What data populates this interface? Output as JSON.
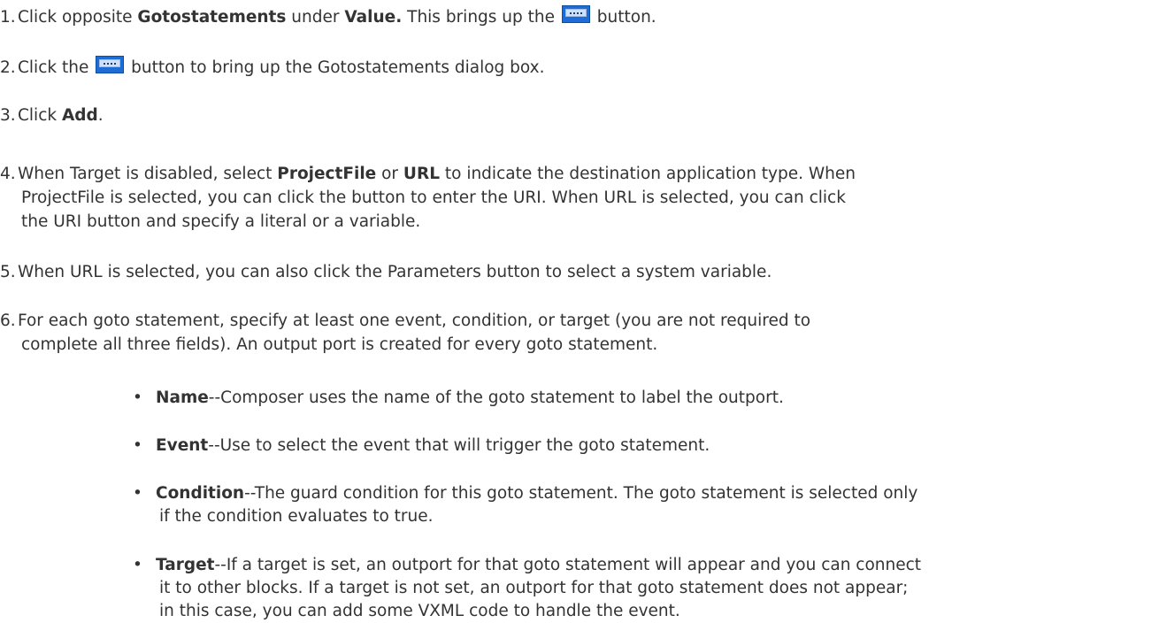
{
  "steps": [
    {
      "num": "1.",
      "pre": "Click opposite ",
      "bold1": "Gotostatements",
      "mid": " under ",
      "bold2": "Value.",
      "post1": " This brings up the ",
      "post2": " button."
    },
    {
      "num": "2.",
      "pre": "Click the ",
      "post": " button to bring up the Gotostatements dialog box."
    },
    {
      "num": "3.",
      "pre": "Click ",
      "bold": "Add",
      "post": "."
    },
    {
      "num": "4.",
      "pre": "When Target is disabled, select ",
      "bold1": "ProjectFile",
      "mid": " or ",
      "bold2": "URL",
      "post": " to indicate the destination application type. When",
      "line2": "ProjectFile is selected, you can click the button to enter the URI. When URL is selected, you can click",
      "line3": "the URI button and specify a literal or a variable."
    },
    {
      "num": "5.",
      "text": "When URL is selected, you can also click the Parameters button to select a system variable."
    },
    {
      "num": "6.",
      "line1": "For each goto statement, specify at least one event, condition, or target (you are not required to",
      "line2": "complete all three fields). An output port is created for every goto statement."
    }
  ],
  "bullets": [
    {
      "label": "Name",
      "text": "--Composer uses the name of the goto statement to label the outport."
    },
    {
      "label": "Event",
      "text": "--Use to select the event that will trigger the goto statement."
    },
    {
      "label": "Condition",
      "line1": "--The guard condition for this goto statement. The goto statement is selected only",
      "line2": "if the condition evaluates to true."
    },
    {
      "label": "Target",
      "line1": "--If a target is set, an outport for that goto statement will appear and you can connect",
      "line2": "it to other blocks. If a target is not set, an outport for that goto statement does not appear;",
      "line3": "in this case, you can add some VXML code to handle the event."
    }
  ],
  "icons": {
    "ellipsis_button": "ellipsis-button-icon"
  },
  "bullet_glyph": "•"
}
